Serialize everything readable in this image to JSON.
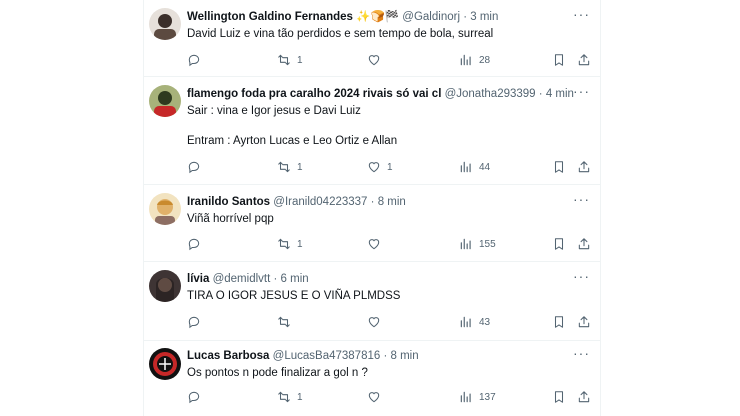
{
  "tweets": [
    {
      "name": "Wellington Galdino Fernandes",
      "badges": "✨🍞🏁",
      "handle": "@Galdinorj",
      "time": "3 min",
      "text": "David Luiz e vina tão perdidos e sem tempo de bola, surreal",
      "retweets": "1",
      "likes": "",
      "views": "28",
      "avatar_color": "#3b2f2a"
    },
    {
      "name": "flamengo foda pra caralho 2024 rivais só vai cl",
      "badges": "",
      "handle": "@Jonatha293399",
      "time": "4 min",
      "text": "Sair : vina e Igor jesus e Davi Luiz\n\nEntram : Ayrton Lucas e Leo Ortiz e Allan",
      "retweets": "1",
      "likes": "1",
      "views": "44",
      "avatar_color": "#4a5a2c"
    },
    {
      "name": "Iranildo Santos",
      "badges": "",
      "handle": "@Iranild04223337",
      "time": "8 min",
      "text": "Viñã horrível pqp",
      "retweets": "1",
      "likes": "",
      "views": "155",
      "avatar_color": "#d9a84f"
    },
    {
      "name": "lívia",
      "badges": "",
      "handle": "@demidlvtt",
      "time": "6 min",
      "text": "TIRA O IGOR JESUS E O VIÑA PLMDSS",
      "retweets": "",
      "likes": "",
      "views": "43",
      "avatar_color": "#2a2222"
    },
    {
      "name": "Lucas Barbosa",
      "badges": "",
      "handle": "@LucasBa47387816",
      "time": "8 min",
      "text": "Os pontos n pode finalizar a gol n ?",
      "retweets": "1",
      "likes": "",
      "views": "137",
      "avatar_color": "#1a1a1a"
    }
  ],
  "separator": "·",
  "icons": {
    "reply": "reply-icon",
    "retweet": "retweet-icon",
    "like": "heart-icon",
    "views": "views-icon",
    "bookmark": "bookmark-icon",
    "share": "share-icon",
    "more": "more-icon"
  }
}
